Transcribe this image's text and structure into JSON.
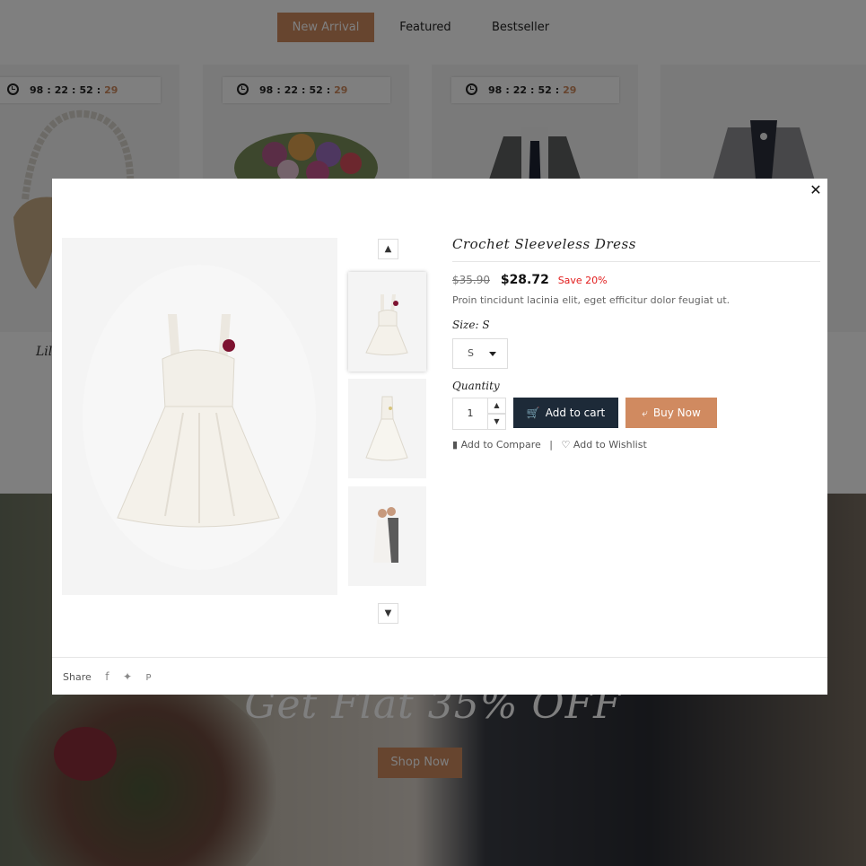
{
  "tabs": [
    {
      "label": "New Arrival",
      "active": true
    },
    {
      "label": "Featured",
      "active": false
    },
    {
      "label": "Bestseller",
      "active": false
    }
  ],
  "products": [
    {
      "countdown": {
        "days": "98",
        "hours": "22",
        "minutes": "52",
        "seconds": "29"
      },
      "title": "Lil"
    },
    {
      "countdown": {
        "days": "98",
        "hours": "22",
        "minutes": "52",
        "seconds": "29"
      }
    },
    {
      "countdown": {
        "days": "98",
        "hours": "22",
        "minutes": "52",
        "seconds": "29"
      }
    },
    {}
  ],
  "banner": {
    "heading": "Get Flat 35% OFF",
    "button_label": "Shop Now"
  },
  "modal": {
    "close_label": "✕",
    "product": {
      "title": "Crochet Sleeveless Dress",
      "old_price": "$35.90",
      "price": "$28.72",
      "save": "Save 20%",
      "description": "Proin tincidunt lacinia elit, eget efficitur dolor feugiat ut.",
      "size_label": "Size: S",
      "size_value": "S",
      "quantity_label": "Quantity",
      "quantity_value": "1",
      "add_to_cart_label": "Add to cart",
      "buy_now_label": "Buy Now",
      "compare_label": "Add to Compare",
      "wishlist_label": "Add to Wishlist",
      "link_separator": "|"
    },
    "share_label": "Share",
    "share_icons": [
      "facebook-icon",
      "twitter-icon",
      "pinterest-icon"
    ],
    "colors": {
      "accent": "#cf8a5f",
      "cart_button": "#1d2a38",
      "save": "#e21c1c"
    }
  }
}
